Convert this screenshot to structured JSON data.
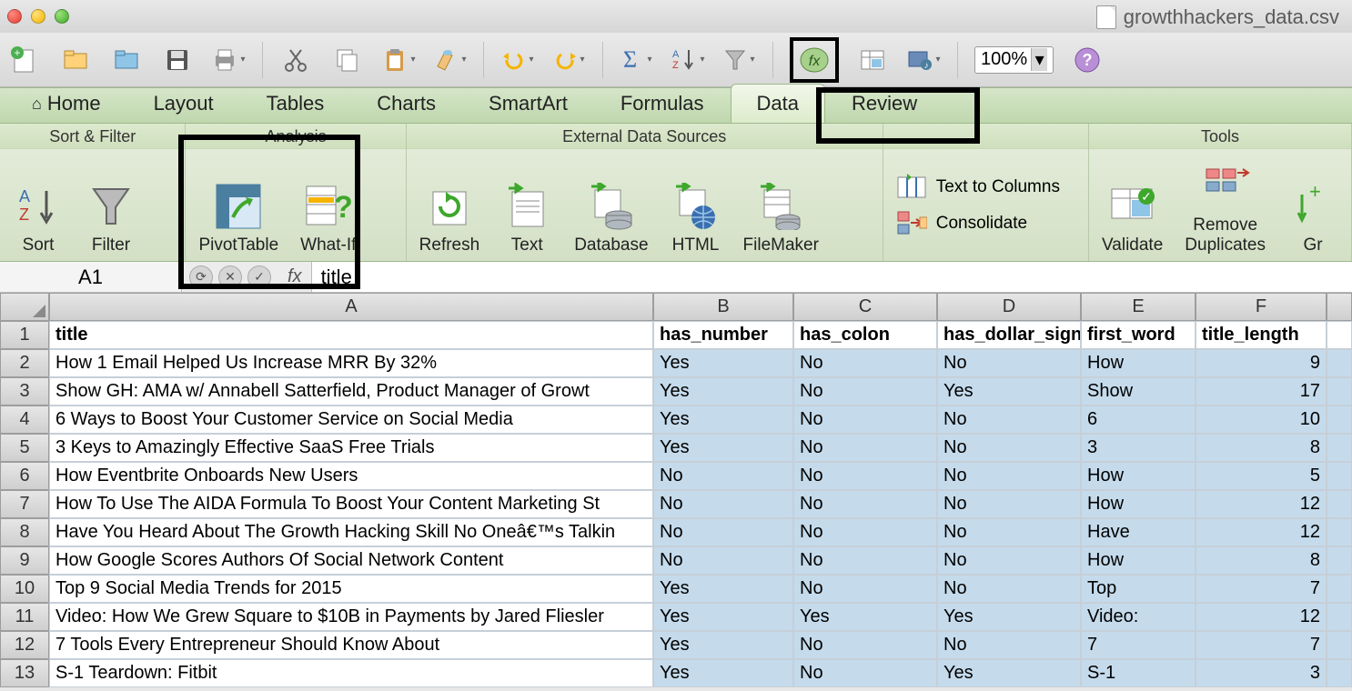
{
  "window": {
    "filename": "growthhackers_data.csv"
  },
  "zoom": "100%",
  "tabs": [
    "Home",
    "Layout",
    "Tables",
    "Charts",
    "SmartArt",
    "Formulas",
    "Data",
    "Review"
  ],
  "active_tab": "Data",
  "ribbon": {
    "groups": [
      {
        "title": "Sort & Filter",
        "buttons": [
          "Sort",
          "Filter"
        ]
      },
      {
        "title": "Analysis",
        "buttons": [
          "PivotTable",
          "What-If"
        ]
      },
      {
        "title": "External Data Sources",
        "buttons": [
          "Refresh",
          "Text",
          "Database",
          "HTML",
          "FileMaker"
        ]
      },
      {
        "title": "",
        "buttons": [
          "Text to Columns",
          "Consolidate"
        ]
      },
      {
        "title": "Tools",
        "buttons": [
          "Validate",
          "Remove Duplicates",
          "Gr"
        ]
      }
    ]
  },
  "formula_bar": {
    "cell_ref": "A1",
    "formula": "title"
  },
  "columns": [
    "A",
    "B",
    "C",
    "D",
    "E",
    "F"
  ],
  "headers": [
    "title",
    "has_number",
    "has_colon",
    "has_dollar_sign",
    "first_word",
    "title_length"
  ],
  "rows": [
    [
      "How 1 Email Helped Us Increase MRR By 32%",
      "Yes",
      "No",
      "No",
      "How",
      "9"
    ],
    [
      "Show GH: AMA w/ Annabell Satterfield, Product Manager of Growt",
      "Yes",
      "No",
      "Yes",
      "Show",
      "17"
    ],
    [
      "6 Ways to Boost Your Customer Service on Social Media",
      "Yes",
      "No",
      "No",
      "6",
      "10"
    ],
    [
      "3 Keys to Amazingly Effective SaaS Free Trials",
      "Yes",
      "No",
      "No",
      "3",
      "8"
    ],
    [
      "How Eventbrite Onboards New Users",
      "No",
      "No",
      "No",
      "How",
      "5"
    ],
    [
      "How To Use The AIDA Formula To Boost Your Content Marketing St",
      "No",
      "No",
      "No",
      "How",
      "12"
    ],
    [
      "Have You Heard About The Growth Hacking Skill No Oneâ€™s Talkin",
      "No",
      "No",
      "No",
      "Have",
      "12"
    ],
    [
      "How Google Scores Authors Of Social Network Content",
      "No",
      "No",
      "No",
      "How",
      "8"
    ],
    [
      "Top 9 Social Media Trends for 2015",
      "Yes",
      "No",
      "No",
      "Top",
      "7"
    ],
    [
      "Video: How We Grew Square to $10B in Payments by Jared Fliesler",
      "Yes",
      "Yes",
      "Yes",
      "Video:",
      "12"
    ],
    [
      "7 Tools Every Entrepreneur Should Know About",
      "Yes",
      "No",
      "No",
      "7",
      "7"
    ],
    [
      "S-1 Teardown: Fitbit",
      "Yes",
      "No",
      "Yes",
      "S-1",
      "3"
    ]
  ]
}
